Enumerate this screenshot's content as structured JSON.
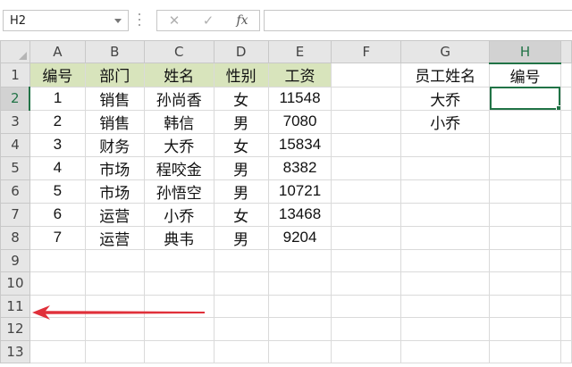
{
  "formula_bar": {
    "name_box": "H2",
    "cancel_icon": "✕",
    "enter_icon": "✓",
    "fx_label": "fx",
    "formula": ""
  },
  "columns": [
    "A",
    "B",
    "C",
    "D",
    "E",
    "F",
    "G",
    "H"
  ],
  "rows": [
    "1",
    "2",
    "3",
    "4",
    "5",
    "6",
    "7",
    "8",
    "9",
    "10",
    "11",
    "12",
    "13"
  ],
  "table": {
    "headers": [
      "编号",
      "部门",
      "姓名",
      "性别",
      "工资"
    ],
    "records": [
      [
        "1",
        "销售",
        "孙尚香",
        "女",
        "11548"
      ],
      [
        "2",
        "销售",
        "韩信",
        "男",
        "7080"
      ],
      [
        "3",
        "财务",
        "大乔",
        "女",
        "15834"
      ],
      [
        "4",
        "市场",
        "程咬金",
        "男",
        "8382"
      ],
      [
        "5",
        "市场",
        "孙悟空",
        "男",
        "10721"
      ],
      [
        "6",
        "运营",
        "小乔",
        "女",
        "13468"
      ],
      [
        "7",
        "运营",
        "典韦",
        "男",
        "9204"
      ]
    ]
  },
  "lookup": {
    "header_name": "员工姓名",
    "header_id": "编号",
    "names": [
      "大乔",
      "小乔"
    ]
  },
  "active_cell": "H2",
  "colors": {
    "header_fill": "#d8e4bc",
    "selection": "#217346",
    "arrow": "#e0303a"
  }
}
